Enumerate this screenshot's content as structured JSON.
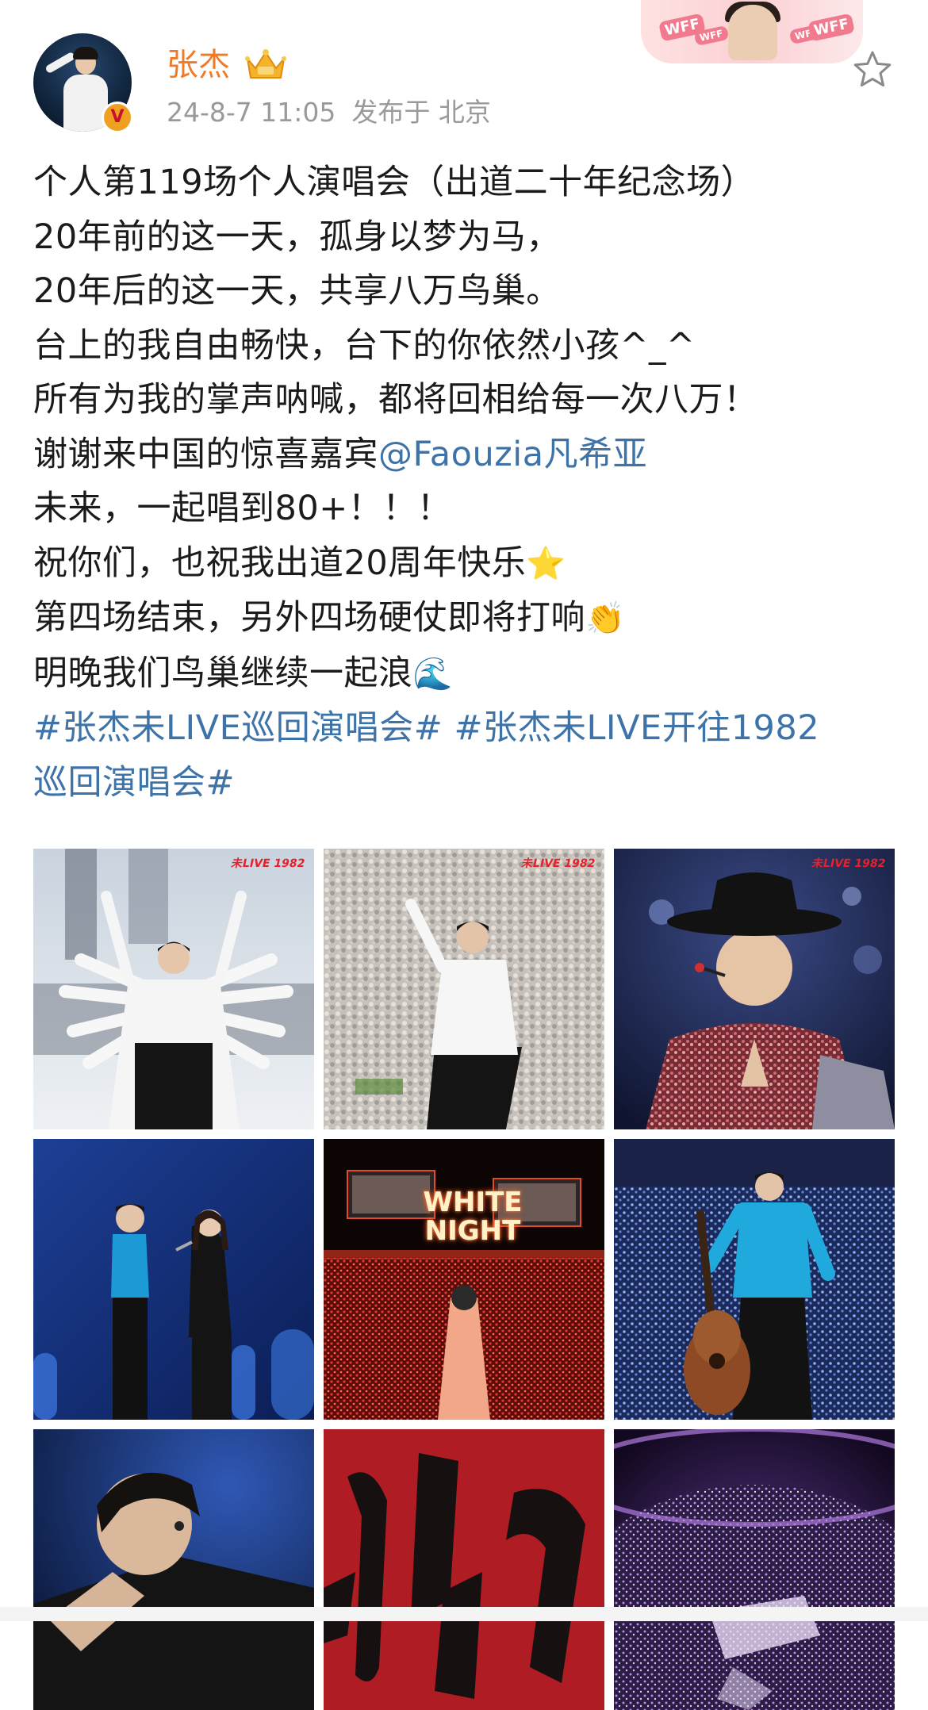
{
  "post": {
    "username": "张杰",
    "timestamp": "24-8-7 11:05",
    "published_from": "发布于 北京",
    "fan_badge_text": "WFF",
    "lines": [
      {
        "text": "个人第119场个人演唱会（出道二十年纪念场）"
      },
      {
        "text": "20年前的这一天，孤身以梦为马，"
      },
      {
        "text": "20年后的这一天，共享八万鸟巢。"
      },
      {
        "text": "台上的我自由畅快，台下的你依然小孩^_^"
      },
      {
        "text": "所有为我的掌声呐喊，都将回相给每一次八万！"
      },
      {
        "text": "谢谢来中国的惊喜嘉宾",
        "mention": "@Faouzia凡希亚"
      },
      {
        "text": "未来，一起唱到80+！！！"
      },
      {
        "text": "祝你们，也祝我出道20周年快乐",
        "emoji": "⭐"
      },
      {
        "text": "第四场结束，另外四场硬仗即将打响",
        "emoji": "👏"
      },
      {
        "text": "明晚我们鸟巢继续一起浪",
        "emoji": "🌊"
      }
    ],
    "hashtags": {
      "line1": "#张杰未LIVE巡回演唱会# #张杰未LIVE开往1982",
      "line2": "巡回演唱会#"
    }
  },
  "images": [
    {
      "name": "photo-white-robe-dancers",
      "logo": "未LIVE 1982"
    },
    {
      "name": "photo-white-shirt-crowd",
      "logo": "未LIVE 1982"
    },
    {
      "name": "photo-black-hat-sequin",
      "logo": "未LIVE 1982"
    },
    {
      "name": "photo-duet-blue-stage",
      "logo": ""
    },
    {
      "name": "photo-white-night-stadium",
      "logo": "",
      "screen_text": "WHITE NIGHT"
    },
    {
      "name": "photo-blue-shirt-guitar",
      "logo": ""
    },
    {
      "name": "photo-closeup-piano",
      "logo": ""
    },
    {
      "name": "photo-red-calligraphy",
      "logo": ""
    },
    {
      "name": "photo-purple-stadium-aerial",
      "logo": ""
    }
  ],
  "colors": {
    "username": "#f07a25",
    "meta": "#9a9a9a",
    "link": "#3e73a8",
    "text": "#1b1b1b"
  },
  "icons": {
    "favorite": "star-outline-icon",
    "verified": "verified-badge-icon",
    "vip": "crown-icon"
  }
}
